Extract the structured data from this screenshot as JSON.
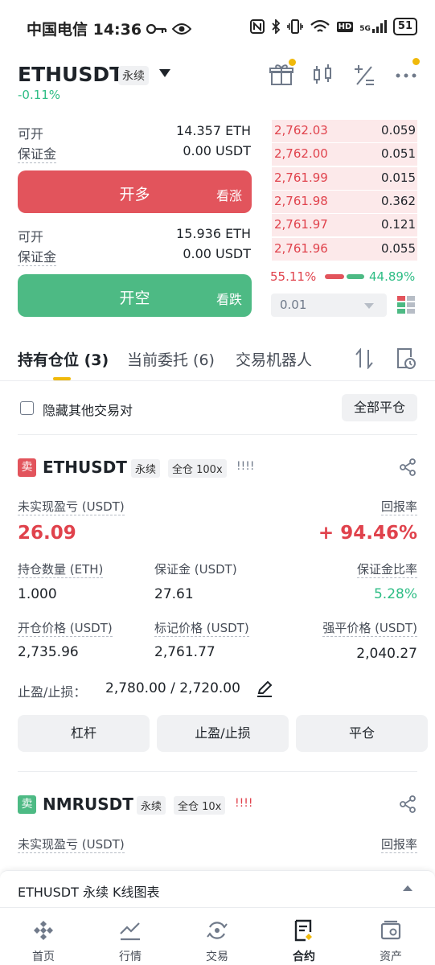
{
  "status_bar": {
    "carrier_time": "中国电信 14:36",
    "network": "5G",
    "hd": "HD",
    "battery": "51"
  },
  "header": {
    "symbol": "ETHUSDT",
    "contract_type": "永续",
    "change": "-0.11%"
  },
  "buy_panel": {
    "available_label": "可开",
    "available_value": "14.357 ETH",
    "margin_label": "保证金",
    "margin_value": "0.00 USDT",
    "button_label": "开多",
    "button_side": "看涨"
  },
  "sell_panel": {
    "available_label": "可开",
    "available_value": "15.936 ETH",
    "margin_label": "保证金",
    "margin_value": "0.00 USDT",
    "button_label": "开空",
    "button_side": "看跌"
  },
  "orderbook": {
    "asks": [
      {
        "price": "2,762.03",
        "qty": "0.059"
      },
      {
        "price": "2,762.00",
        "qty": "0.051"
      },
      {
        "price": "2,761.99",
        "qty": "0.015"
      },
      {
        "price": "2,761.98",
        "qty": "0.362"
      },
      {
        "price": "2,761.97",
        "qty": "0.121"
      },
      {
        "price": "2,761.96",
        "qty": "0.055"
      }
    ],
    "buy_ratio": "55.11%",
    "sell_ratio": "44.89%",
    "precision": "0.01"
  },
  "tabs": [
    {
      "label": "持有仓位 (3)"
    },
    {
      "label": "当前委托 (6)"
    },
    {
      "label": "交易机器人"
    }
  ],
  "filter": {
    "hide_others_label": "隐藏其他交易对",
    "close_all_label": "全部平仓"
  },
  "positions": [
    {
      "side": "卖",
      "symbol": "ETHUSDT",
      "type": "永续",
      "margin_mode": "全仓 100x",
      "risk": "!!!!",
      "pnl_label": "未实现盈亏 (USDT)",
      "pnl_value": "26.09",
      "roe_label": "回报率",
      "roe_value": "+ 94.46%",
      "size_label": "持仓数量 (ETH)",
      "size_value": "1.000",
      "margin_label": "保证金 (USDT)",
      "margin_value": "27.61",
      "margin_ratio_label": "保证金比率",
      "margin_ratio_value": "5.28%",
      "entry_label": "开仓价格 (USDT)",
      "entry_value": "2,735.96",
      "mark_label": "标记价格 (USDT)",
      "mark_value": "2,761.77",
      "liq_label": "强平价格 (USDT)",
      "liq_value": "2,040.27",
      "tpsl_label": "止盈/止损：",
      "tpsl_value": "2,780.00 / 2,720.00",
      "btn_leverage": "杠杆",
      "btn_tpsl": "止盈/止损",
      "btn_close": "平仓"
    },
    {
      "side": "卖",
      "symbol": "NMRUSDT",
      "type": "永续",
      "margin_mode": "全仓 10x",
      "risk": "!!!!",
      "pnl_label": "未实现盈亏 (USDT)",
      "roe_label": "回报率"
    }
  ],
  "chart_bar": {
    "label": "ETHUSDT 永续 K线图表"
  },
  "nav": [
    {
      "label": "首页"
    },
    {
      "label": "行情"
    },
    {
      "label": "交易"
    },
    {
      "label": "合约"
    },
    {
      "label": "资产"
    }
  ],
  "colors": {
    "red": "#e0424c",
    "green": "#2ebd85",
    "accent": "#f0b90b"
  }
}
